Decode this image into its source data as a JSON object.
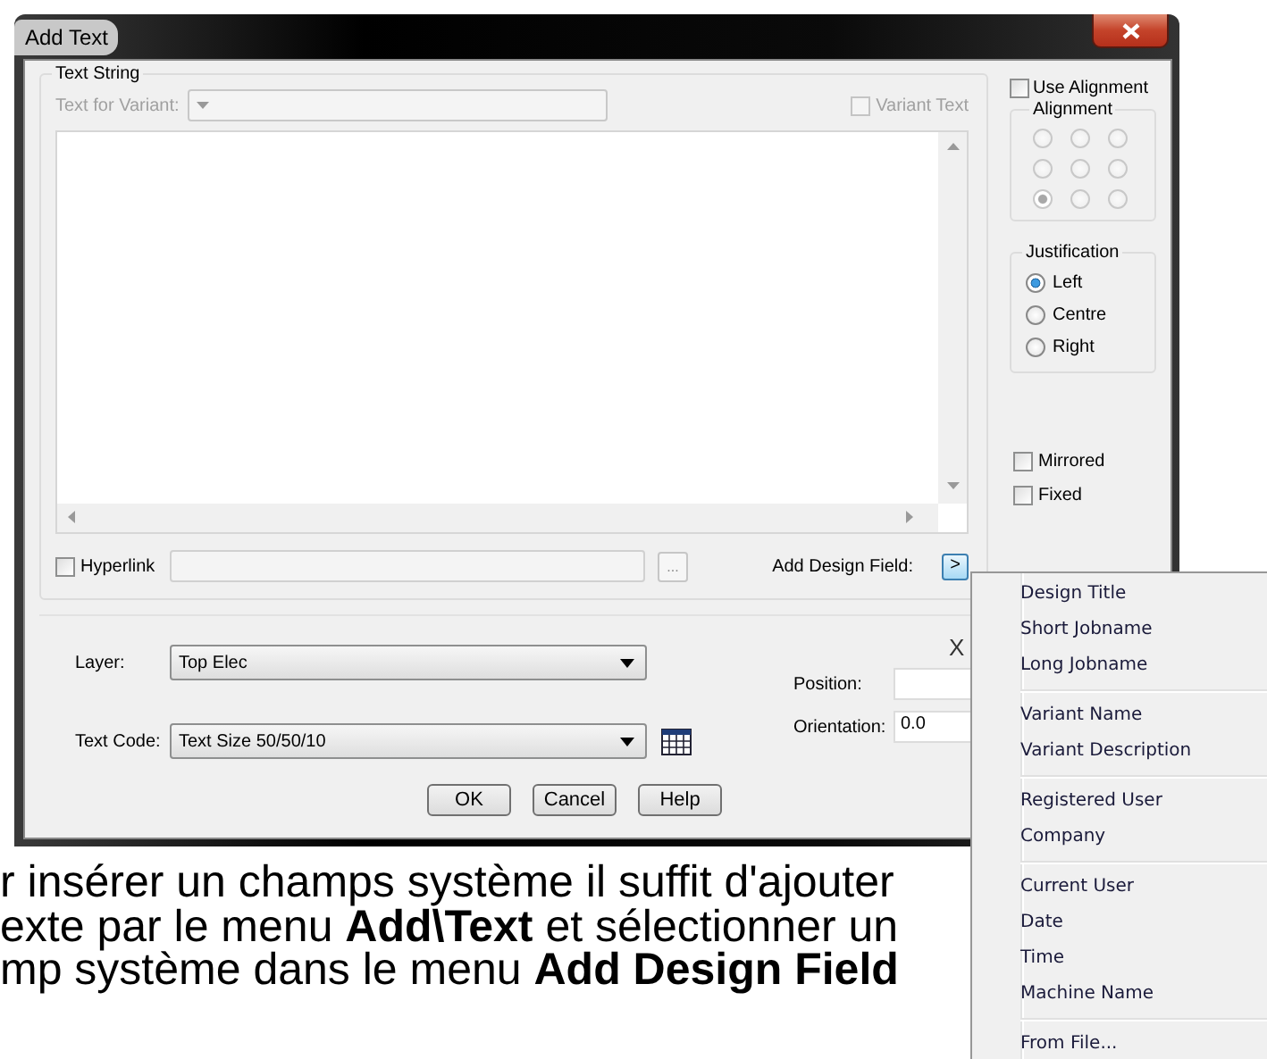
{
  "window": {
    "title": "Add Text"
  },
  "text_string": {
    "title": "Text String",
    "variant_label": "Text for Variant:",
    "variant_disabled": true,
    "variant_text": {
      "label": "Variant Text",
      "checked": false,
      "disabled": true
    },
    "hyperlink": {
      "label": "Hyperlink",
      "checked": false
    },
    "browse_button": "...",
    "add_design_field": {
      "label": "Add Design Field:",
      "button": ">"
    }
  },
  "use_alignment": {
    "label": "Use Alignment",
    "checked": false
  },
  "alignment": {
    "title": "Alignment",
    "disabled": true,
    "options": [
      {
        "selected": false
      },
      {
        "selected": false
      },
      {
        "selected": false
      },
      {
        "selected": false
      },
      {
        "selected": false
      },
      {
        "selected": false
      },
      {
        "selected": true
      },
      {
        "selected": false
      },
      {
        "selected": false
      }
    ]
  },
  "justification": {
    "title": "Justification",
    "options": [
      {
        "label": "Left",
        "selected": true
      },
      {
        "label": "Centre",
        "selected": false
      },
      {
        "label": "Right",
        "selected": false
      }
    ]
  },
  "mirrored": {
    "label": "Mirrored",
    "checked": false
  },
  "fixed": {
    "label": "Fixed",
    "checked": false
  },
  "layer": {
    "label": "Layer:",
    "value": "Top Elec"
  },
  "text_code": {
    "label": "Text Code:",
    "value": "Text Size 50/50/10"
  },
  "x_heading": "X",
  "position": {
    "label": "Position:"
  },
  "orientation": {
    "label": "Orientation:",
    "value": "0.0"
  },
  "buttons": [
    "OK",
    "Cancel",
    "Help"
  ],
  "design_field_menu": {
    "groups": [
      {
        "items": [
          "Design Title",
          "Short Jobname",
          "Long Jobname"
        ]
      },
      {
        "items": [
          "Variant Name",
          "Variant Description"
        ]
      },
      {
        "items": [
          "Registered User",
          "Company"
        ]
      },
      {
        "items": [
          "Current User",
          "Date",
          "Time",
          "Machine Name"
        ]
      },
      {
        "items": [
          "From File..."
        ]
      }
    ]
  },
  "caption": {
    "lines": [
      "r insérer un champs système il suffit d'ajouter",
      "exte par le menu **Add\\Text** et sélectionner un",
      "mp système dans le menu **Add Design Field**"
    ]
  }
}
